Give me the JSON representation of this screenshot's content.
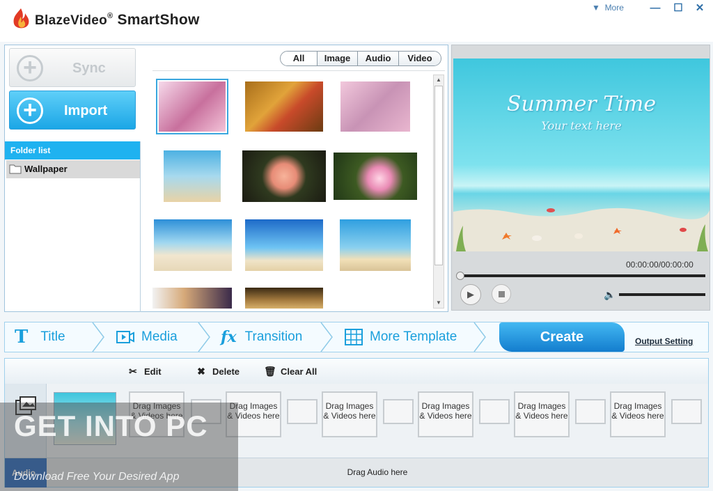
{
  "window": {
    "brand_prefix": "BlazeVideo",
    "brand_mark": "®",
    "brand_name": "SmartShow",
    "more_label": "More",
    "minimize": "—",
    "maximize": "☐",
    "close": "✕"
  },
  "left": {
    "sync_label": "Sync",
    "import_label": "Import",
    "folder_header": "Folder list",
    "folder_item": "Wallpaper"
  },
  "filters": [
    "All",
    "Image",
    "Audio",
    "Video"
  ],
  "thumbnails": [
    {
      "name": "magnolia",
      "bg": "linear-gradient(135deg,#f6d9ea,#c8709d 55%,#f3c3d8)"
    },
    {
      "name": "mushroom-leaves",
      "bg": "linear-gradient(135deg,#a86e1a,#e1a33a 40%,#c84a2a 60%,#6b3c12)"
    },
    {
      "name": "pink-flower",
      "bg": "linear-gradient(135deg,#f2c8dc,#c893b5 50%,#e9b6cf)"
    },
    {
      "name": "beach-palm",
      "bg": "linear-gradient(#4db1e2,#a7d9ee 50%,#e9d3a6)"
    },
    {
      "name": "rose",
      "bg": "radial-gradient(circle at 50% 50%,#f7b39a 0,#e78c77 25%,#2f3a1f 45%,#1b1b12 100%)"
    },
    {
      "name": "water-lily",
      "bg": "radial-gradient(circle at 55% 55%,#ffd6e6 0,#e98ab4 22%,#3d5a22 45%,#1f3516 100%)"
    },
    {
      "name": "sea-shore",
      "bg": "linear-gradient(#2d8fd8,#9fd7f0 45%,#f1e6cf 70%,#e7d8b8)"
    },
    {
      "name": "ocean-sun",
      "bg": "linear-gradient(#1d6ac8,#6ec4f3 55%,#f0e4c8 80%,#e4d1a6)"
    },
    {
      "name": "palm-island",
      "bg": "linear-gradient(#2f9fe0,#8ad0ef 55%,#f1e0b8 78%,#d9c397)"
    },
    {
      "name": "puppy",
      "bg": "linear-gradient(90deg,#f2f2f2,#d6a979 40%,#3a2a4a)"
    },
    {
      "name": "lion",
      "bg": "linear-gradient(#3a2a14,#a57b3f 60%,#d6b06a)"
    }
  ],
  "preview": {
    "title": "Summer Time",
    "subtitle": "Your text here",
    "time": "00:00:00/00:00:00",
    "progress": 0,
    "volume": 1
  },
  "steps": {
    "title": "Title",
    "media": "Media",
    "transition": "Transition",
    "more_template": "More Template",
    "create": "Create",
    "output_setting": "Output Setting"
  },
  "timeline": {
    "edit": "Edit",
    "delete": "Delete",
    "clear_all": "Clear All",
    "slot_text": "Drag Images & Videos here",
    "audio_label": "Audio",
    "audio_drop": "Drag Audio here"
  },
  "watermark": {
    "title": "GET INTO PC",
    "subtitle": "Download Free Your Desired App"
  }
}
